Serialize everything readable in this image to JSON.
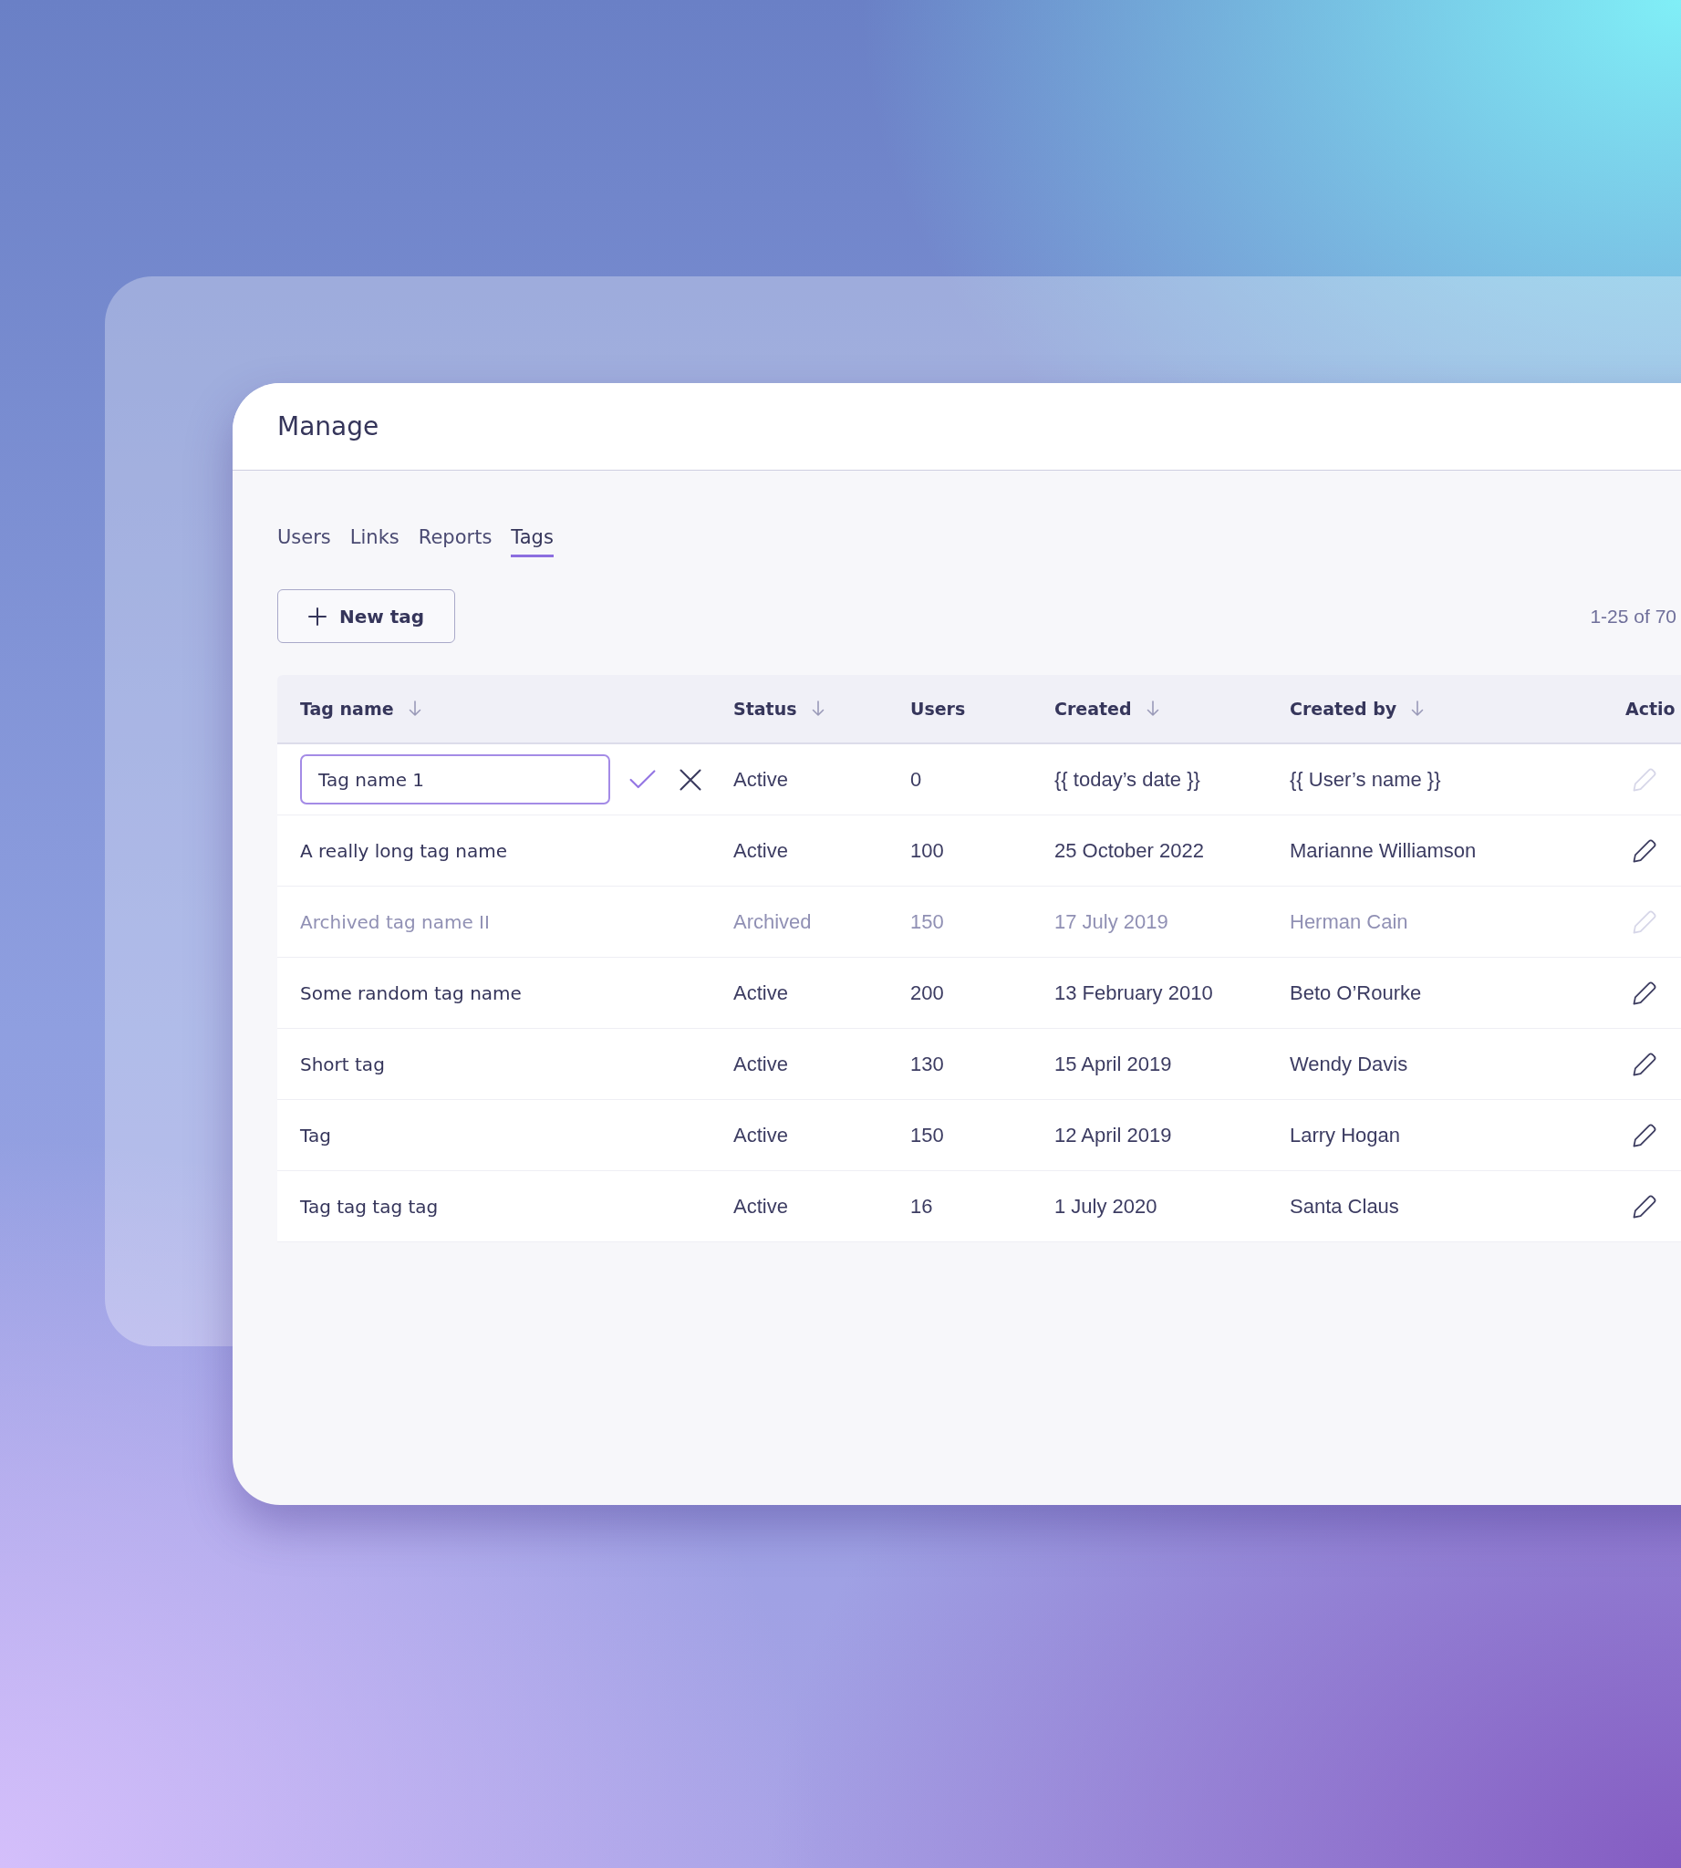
{
  "window": {
    "title": "Manage"
  },
  "tabs": [
    {
      "label": "Users",
      "selected": false
    },
    {
      "label": "Links",
      "selected": false
    },
    {
      "label": "Reports",
      "selected": false
    },
    {
      "label": "Tags",
      "selected": true
    }
  ],
  "new_tag_button": {
    "label": "New tag"
  },
  "pagination": {
    "range": "1-25 of 70"
  },
  "table": {
    "columns": [
      {
        "label": "Tag name",
        "sortable": true
      },
      {
        "label": "Status",
        "sortable": true
      },
      {
        "label": "Users",
        "sortable": false
      },
      {
        "label": "Created",
        "sortable": true
      },
      {
        "label": "Created by",
        "sortable": true
      },
      {
        "label": "Actio",
        "sortable": false
      }
    ],
    "rows": [
      {
        "kind": "edit",
        "tag_name": "Tag name 1",
        "status": "Active",
        "users": "0",
        "created": "{{ today’s date }}",
        "created_by": "{{ User’s name }}",
        "archived": false,
        "edit_disabled": true
      },
      {
        "kind": "display",
        "tag_name": "A really long tag name",
        "status": "Active",
        "users": "100",
        "created": "25 October 2022",
        "created_by": "Marianne Williamson",
        "archived": false,
        "edit_disabled": false
      },
      {
        "kind": "display",
        "tag_name": "Archived tag name II",
        "status": "Archived",
        "users": "150",
        "created": "17 July 2019",
        "created_by": "Herman Cain",
        "archived": true,
        "edit_disabled": true
      },
      {
        "kind": "display",
        "tag_name": "Some random tag name",
        "status": "Active",
        "users": "200",
        "created": "13 February 2010",
        "created_by": "Beto O’Rourke",
        "archived": false,
        "edit_disabled": false
      },
      {
        "kind": "display",
        "tag_name": "Short tag",
        "status": "Active",
        "users": "130",
        "created": "15 April 2019",
        "created_by": "Wendy Davis",
        "archived": false,
        "edit_disabled": false
      },
      {
        "kind": "display",
        "tag_name": "Tag",
        "status": "Active",
        "users": "150",
        "created": "12 April 2019",
        "created_by": "Larry Hogan",
        "archived": false,
        "edit_disabled": false
      },
      {
        "kind": "display",
        "tag_name": "Tag tag tag tag",
        "status": "Active",
        "users": "16",
        "created": "1 July 2020",
        "created_by": "Santa Claus",
        "archived": false,
        "edit_disabled": false
      }
    ]
  }
}
